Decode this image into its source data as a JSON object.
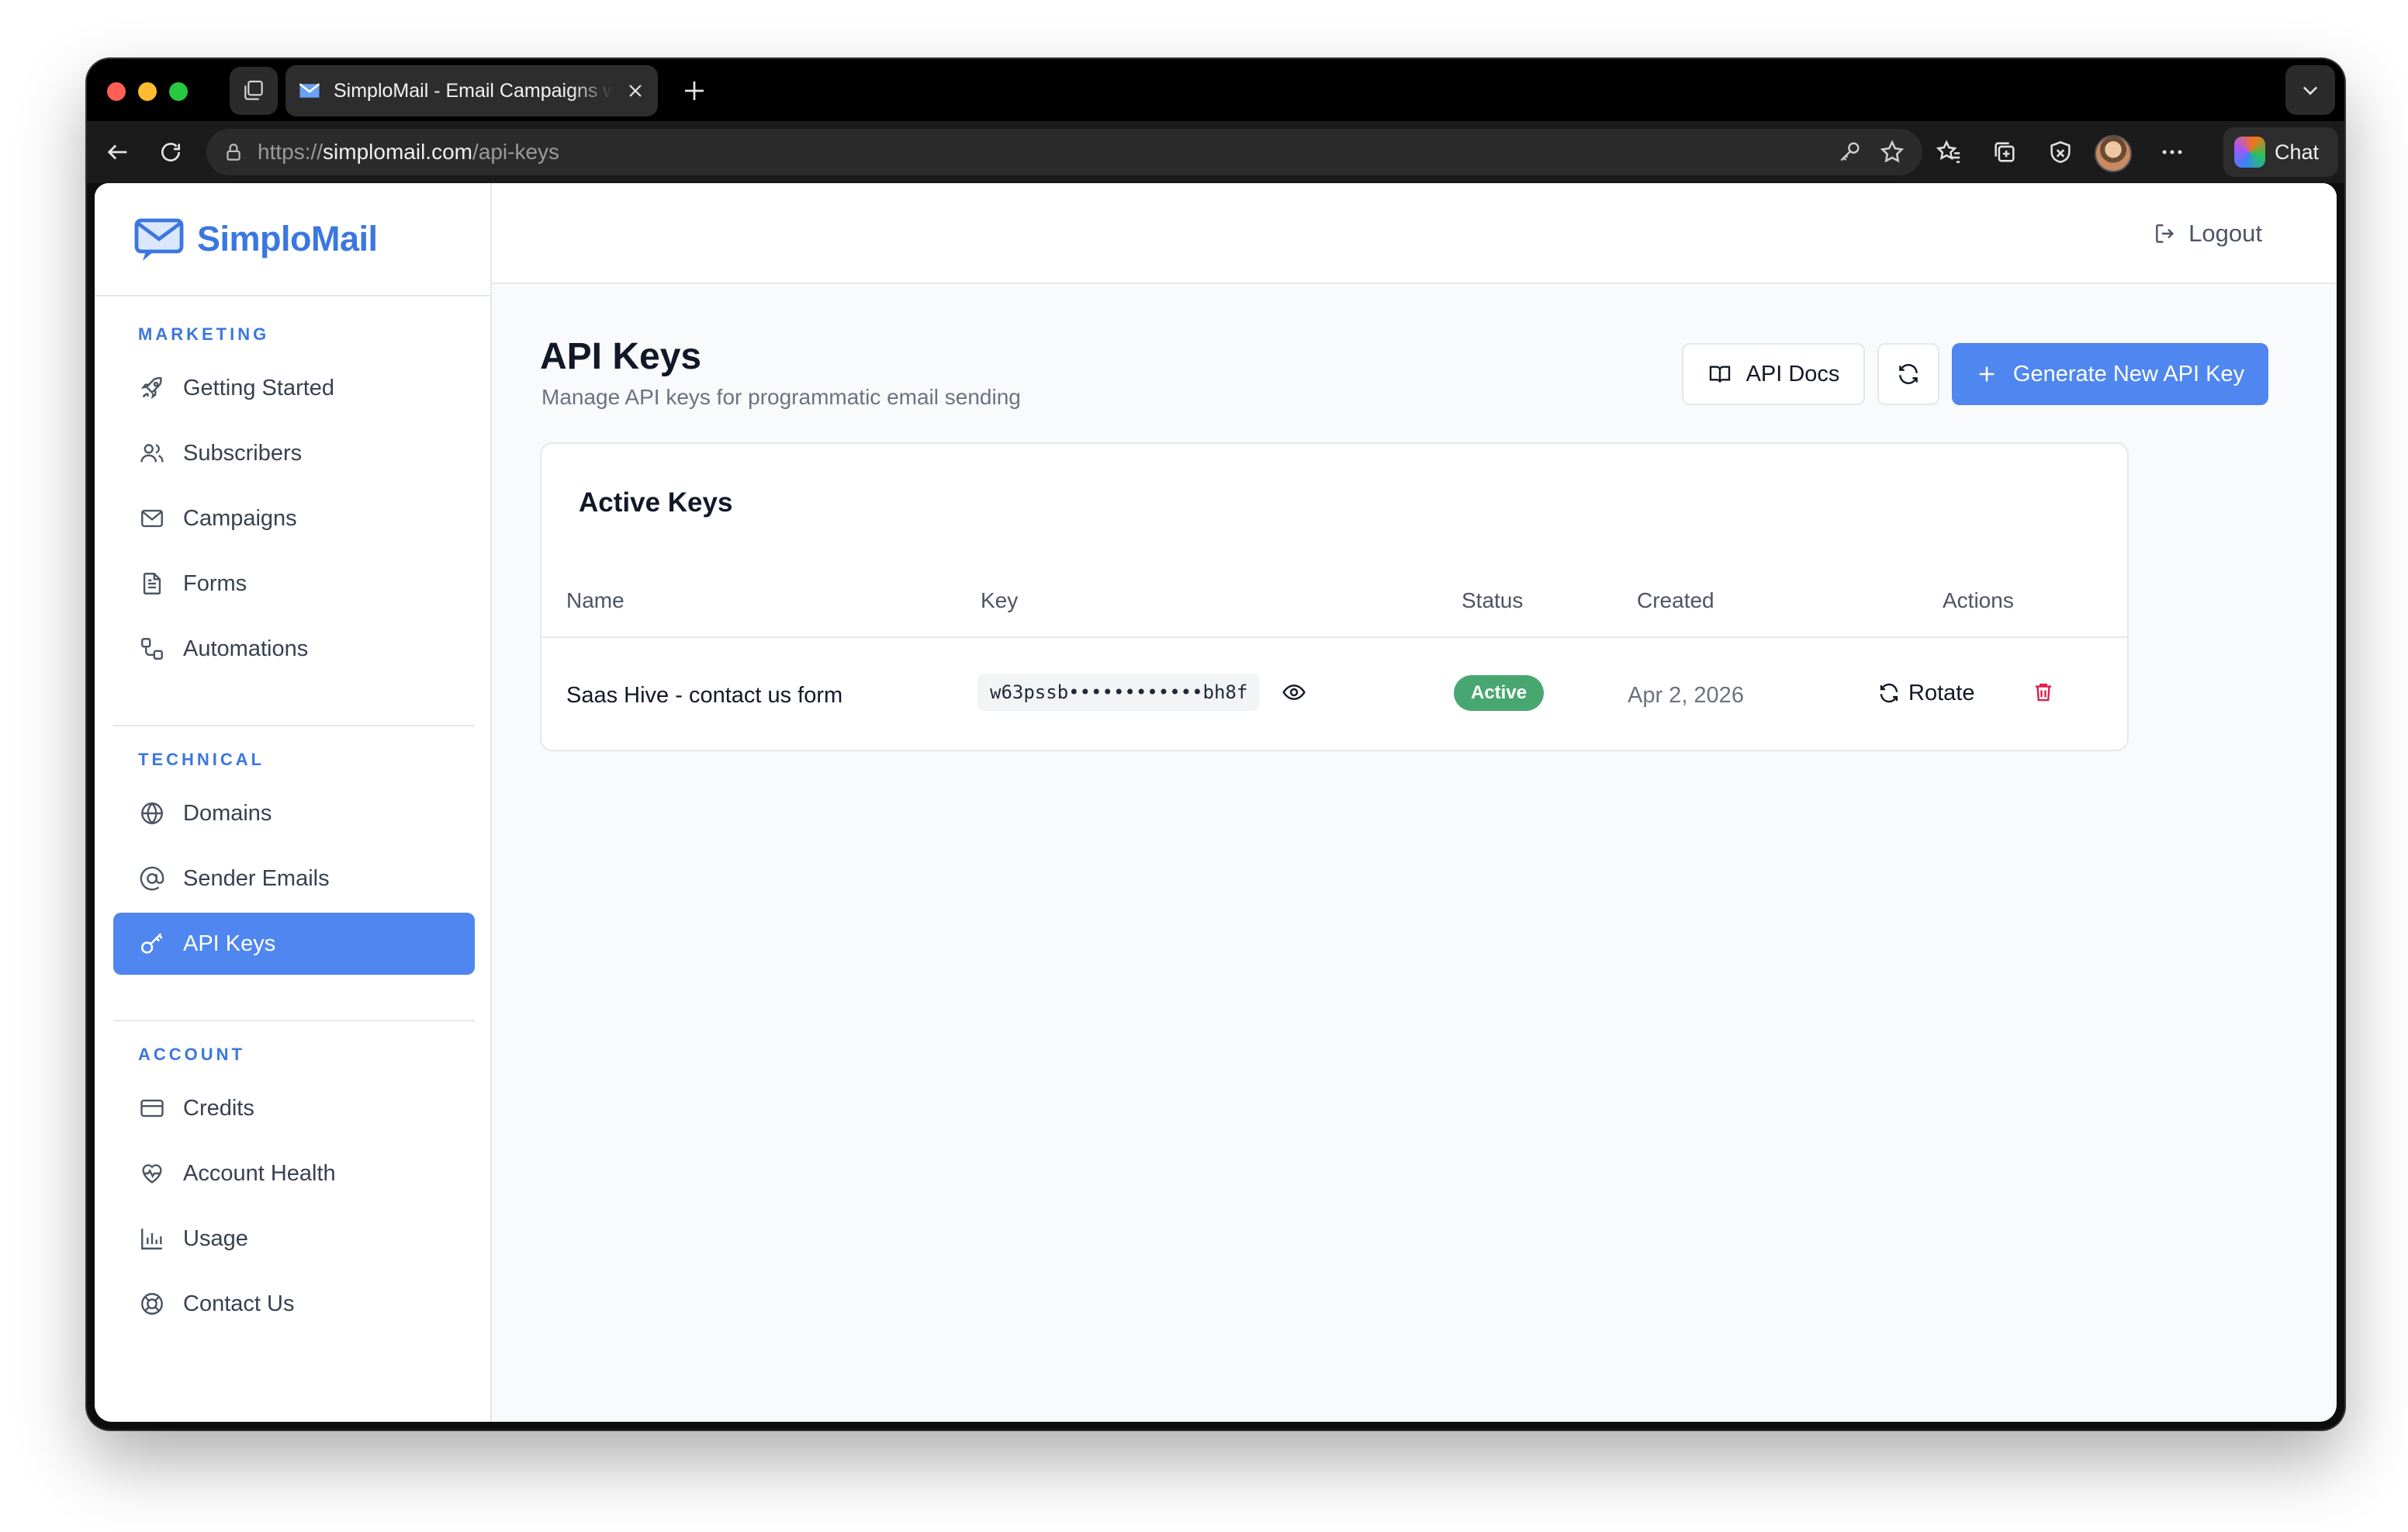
{
  "browser": {
    "tab_title": "SimploMail - Email Campaigns w",
    "url_prefix": "https://",
    "url_host": "simplomail.com",
    "url_path": "/api-keys",
    "chat_label": "Chat"
  },
  "app": {
    "logo_text": "SimploMail",
    "logout_label": "Logout"
  },
  "sidebar": {
    "sections": [
      {
        "title": "MARKETING",
        "items": [
          {
            "label": "Getting Started",
            "icon": "rocket-icon"
          },
          {
            "label": "Subscribers",
            "icon": "users-icon"
          },
          {
            "label": "Campaigns",
            "icon": "mail-icon"
          },
          {
            "label": "Forms",
            "icon": "file-text-icon"
          },
          {
            "label": "Automations",
            "icon": "workflow-icon"
          }
        ]
      },
      {
        "title": "TECHNICAL",
        "items": [
          {
            "label": "Domains",
            "icon": "globe-icon"
          },
          {
            "label": "Sender Emails",
            "icon": "at-sign-icon"
          },
          {
            "label": "API Keys",
            "icon": "key-icon",
            "active": true
          }
        ]
      },
      {
        "title": "ACCOUNT",
        "items": [
          {
            "label": "Credits",
            "icon": "credit-card-icon"
          },
          {
            "label": "Account Health",
            "icon": "heart-pulse-icon"
          },
          {
            "label": "Usage",
            "icon": "bar-chart-icon"
          },
          {
            "label": "Contact Us",
            "icon": "life-buoy-icon"
          }
        ]
      }
    ]
  },
  "page": {
    "title": "API Keys",
    "subtitle": "Manage API keys for programmatic email sending",
    "docs_button": "API Docs",
    "generate_button": "Generate New API Key"
  },
  "card": {
    "title": "Active Keys",
    "columns": [
      "Name",
      "Key",
      "Status",
      "Created",
      "Actions"
    ],
    "rows": [
      {
        "name": "Saas Hive - contact us form",
        "key": "w63pssb••••••••••••bh8f",
        "status": "Active",
        "created": "Apr 2, 2026",
        "rotate_label": "Rotate"
      }
    ]
  },
  "colors": {
    "accent": "#4f86f0",
    "brand": "#3b77e0",
    "status_active": "#48a770",
    "danger": "#e11d48"
  }
}
